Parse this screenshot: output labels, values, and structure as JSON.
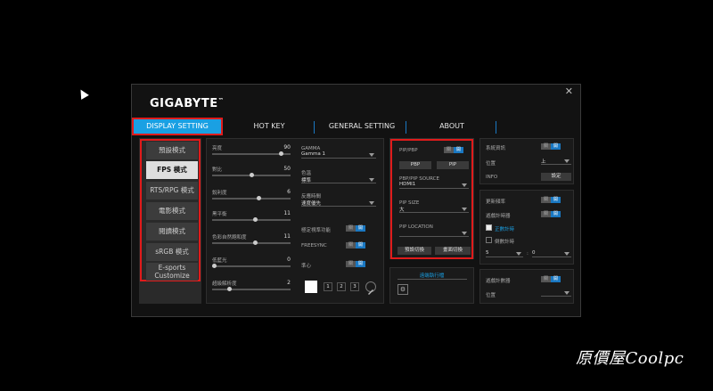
{
  "window": {
    "logo": "GIGABYTE",
    "logo_mark": "™",
    "close": "✕"
  },
  "tabs": [
    {
      "label": "DISPLAY SETTING",
      "active": true
    },
    {
      "label": "HOT KEY"
    },
    {
      "label": "GENERAL SETTING"
    },
    {
      "label": "ABOUT"
    }
  ],
  "presets": [
    "預設模式",
    "FPS 模式",
    "RTS/RPG 模式",
    "電影模式",
    "閱讀模式",
    "sRGB 模式",
    "E-sports",
    "Customize"
  ],
  "sliders": [
    {
      "label": "亮度",
      "value": "90",
      "pos": 0.9
    },
    {
      "label": "對比",
      "value": "50",
      "pos": 0.5
    },
    {
      "label": "銳利度",
      "value": "6",
      "pos": 0.6
    },
    {
      "label": "黑平衡",
      "value": "11",
      "pos": 0.55
    },
    {
      "label": "色彩自然飽和度",
      "value": "11",
      "pos": 0.55
    },
    {
      "label": "低藍光",
      "value": "0",
      "pos": 0.0
    },
    {
      "label": "超級解析度",
      "value": "2",
      "pos": 0.2
    }
  ],
  "middle": {
    "gamma_label": "GAMMA",
    "gamma_value": "Gamma 1",
    "color_label": "色溫",
    "color_value": "標準",
    "response_label": "反應時間",
    "response_value": "速度優先",
    "aim_label": "極定視準功能",
    "freesync_label": "FREESYNC",
    "crosshair_label": "準心",
    "toggle_off": "關",
    "toggle_on": "開",
    "page_buttons": [
      "1",
      "2",
      "3"
    ]
  },
  "pbp": {
    "title": "PIP/PBP",
    "pbp_btn": "PBP",
    "pip_btn": "PIP",
    "source_label": "PBP/PIP SOURCE",
    "source_value": "HDMI1",
    "size_label": "PIP SIZE",
    "size_value": "大",
    "location_label": "PIP LOCATION",
    "location_value": "",
    "reset_btn": "預設切換",
    "swap_btn": "畫面切換"
  },
  "bottom_center": {
    "title": "遠端執行檔"
  },
  "right_top": {
    "sys_label": "系統資訊",
    "pos_label": "位置",
    "pos_value": "上",
    "info_label": "INFO",
    "info_btn": "設定"
  },
  "right_mid": {
    "refresh_label": "更新頻率",
    "timer_label": "遊戲計時器",
    "countup_label": "正數計時",
    "countdown_label": "倒數計時",
    "min_value": "5",
    "colon": ":",
    "sec_value": "0"
  },
  "right_bot": {
    "counter_label": "遊戲計數器",
    "pos_label": "位置"
  },
  "watermark": "原價屋Coolpc"
}
